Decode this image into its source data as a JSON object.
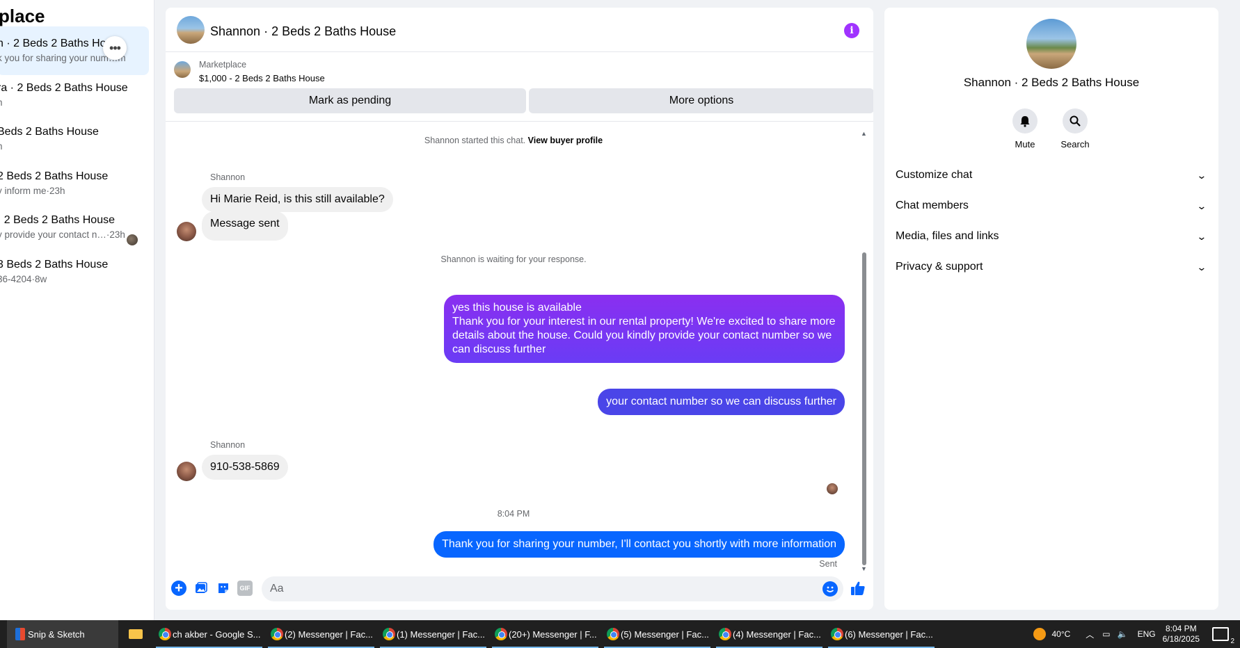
{
  "left": {
    "title": "place",
    "conversations": [
      {
        "title": "n · 2 Beds 2 Baths Hous",
        "sub": "k you for sharing your num…m",
        "active": true
      },
      {
        "title": "ra · 2 Beds 2 Baths House",
        "sub": "h"
      },
      {
        "title": "Beds 2 Baths House",
        "sub": "h"
      },
      {
        "title": " 2 Beds 2 Baths House",
        "sub": "y inform me·23h"
      },
      {
        "title": " · 2 Beds 2 Baths House",
        "sub": "y provide your contact n…·23h"
      },
      {
        "title": "3 Beds 2 Baths House",
        "sub": "36-4204·8w"
      }
    ],
    "more_label": "•••"
  },
  "chat": {
    "title": "Shannon · 2 Beds 2 Baths House",
    "info_icon": "i",
    "marketplace_label": "Marketplace",
    "listing": "$1,000 - 2 Beds 2 Baths House",
    "pending_label": "Mark as pending",
    "more_options_label": "More options",
    "started_text": "Shannon started this chat.",
    "view_profile": "View buyer profile",
    "sender1": "Shannon",
    "msg_in_1": "Hi Marie Reid, is this still available?",
    "msg_in_2": "Message sent",
    "waiting": "Shannon is waiting for your response.",
    "msg_out_1a": "yes this house is available",
    "msg_out_1b": "Thank you for your interest in our rental property! We're excited to share more details about the house. Could you kindly provide your contact number so we can discuss further",
    "msg_out_2": "your contact number so we can discuss further",
    "sender2": "Shannon",
    "msg_in_3": "910-538-5869",
    "time_sep": "8:04 PM",
    "msg_out_3": "Thank you for sharing your number, I'll contact you shortly with more information",
    "sent_label": "Sent",
    "composer_placeholder": "Aa",
    "gif_label": "GIF",
    "colors": {
      "out_purple": "#7b3cf5",
      "out_blue": "#3f4fe8",
      "out_last": "#0866ff",
      "accent": "#0866ff"
    }
  },
  "right": {
    "title": "Shannon · 2 Beds 2 Baths House",
    "mute_label": "Mute",
    "search_label": "Search",
    "sections": [
      "Customize chat",
      "Chat members",
      "Media, files and links",
      "Privacy & support"
    ]
  },
  "taskbar": {
    "snip": "Snip & Sketch",
    "chrome_tabs": [
      "ch akber - Google S...",
      "(2) Messenger | Fac...",
      "(1) Messenger | Fac...",
      "(20+) Messenger | F...",
      "(5) Messenger | Fac...",
      "(4) Messenger | Fac...",
      "(6) Messenger | Fac..."
    ],
    "weather": "40°C",
    "lang": "ENG",
    "time": "8:04 PM",
    "date": "6/18/2025",
    "notif_count": "2"
  }
}
